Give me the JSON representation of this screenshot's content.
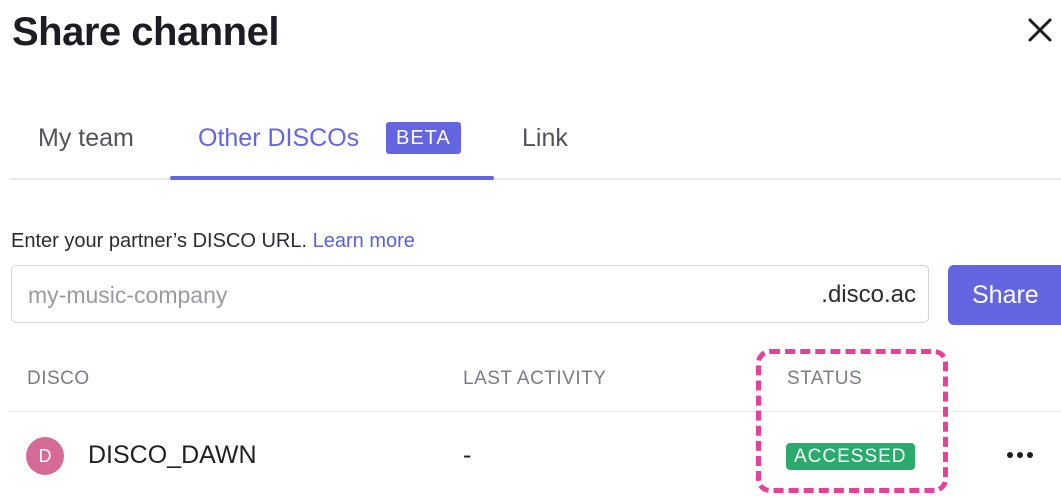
{
  "dialog": {
    "title": "Share channel",
    "close_icon": "close-icon"
  },
  "tabs": [
    {
      "label": "My team",
      "active": false
    },
    {
      "label": "Other DISCOs",
      "active": true,
      "badge": "BETA"
    },
    {
      "label": "Link",
      "active": false
    }
  ],
  "instructions": {
    "text": "Enter your partner’s DISCO URL.",
    "link": "Learn more"
  },
  "url_input": {
    "placeholder": "my-music-company",
    "value": "",
    "suffix": ".disco.ac"
  },
  "share_button": {
    "label": "Share"
  },
  "table": {
    "columns": [
      "DISCO",
      "LAST ACTIVITY",
      "STATUS"
    ],
    "rows": [
      {
        "avatar": "D",
        "name": "DISCO_DAWN",
        "last_activity": "-",
        "status": "ACCESSED",
        "menu_icon": "more-horizontal-icon"
      }
    ]
  },
  "colors": {
    "accent": "#6366e0",
    "status_accessed": "#2aaa6d",
    "avatar": "#d56a97",
    "highlight": "#e7409a"
  }
}
